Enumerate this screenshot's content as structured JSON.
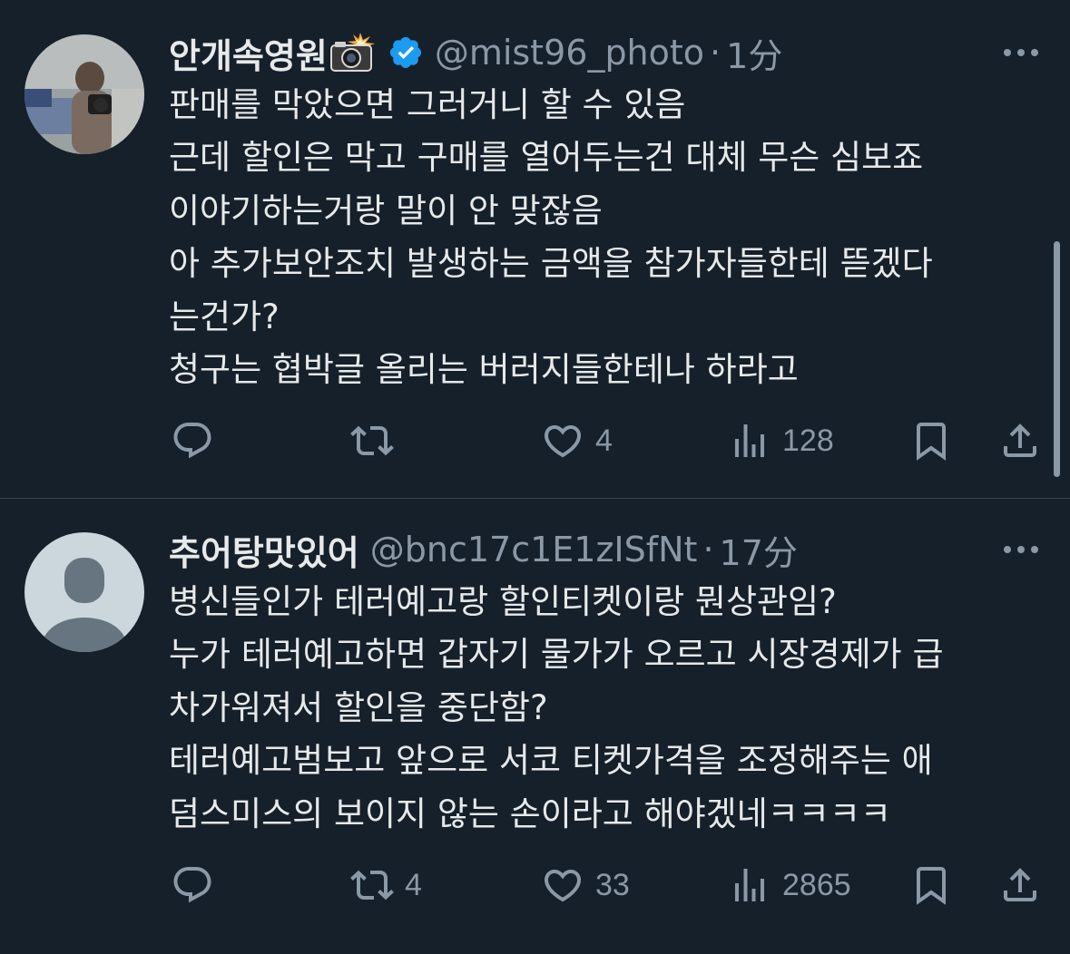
{
  "tweets": [
    {
      "display_name": "안개속영원",
      "display_name_emoji": "camera-with-flash",
      "verified": true,
      "handle": "@mist96_photo",
      "separator": "·",
      "time": "1分",
      "lines": [
        "판매를 막았으면 그러거니 할 수 있음",
        "근데 할인은 막고 구매를 열어두는건 대체 무슨 심보죠",
        "이야기하는거랑 말이 안 맞잖음",
        "아 추가보안조치 발생하는 금액을 참가자들한테 뜯겠다",
        "는건가?",
        "청구는 협박글 올리는 버러지들한테나 하라고"
      ],
      "actions": {
        "reply": "",
        "retweet": "",
        "like": "4",
        "views": "128"
      }
    },
    {
      "display_name": "추어탕맛있어",
      "handle": "@bnc17c1E1zISfNt",
      "separator": "·",
      "time": "17分",
      "lines": [
        "병신들인가 테러예고랑 할인티켓이랑 뭔상관임?",
        "누가 테러예고하면 갑자기 물가가 오르고 시장경제가 급",
        "차가워져서 할인을 중단함?",
        "테러예고범보고 앞으로 서코 티켓가격을 조정해주는 애",
        "덤스미스의 보이지 않는 손이라고 해야겠네ㅋㅋㅋㅋ"
      ],
      "actions": {
        "reply": "",
        "retweet": "4",
        "like": "33",
        "views": "2865"
      }
    }
  ],
  "icons": {
    "reply": "reply-icon",
    "retweet": "retweet-icon",
    "like": "heart-icon",
    "views": "views-icon",
    "bookmark": "bookmark-icon",
    "share": "share-icon",
    "more": "more-dots-icon"
  },
  "colors": {
    "background": "#15202b",
    "text": "#e7e9ea",
    "secondary": "#8b98a5",
    "verified": "#1d9bf0",
    "divider": "#38444d"
  }
}
